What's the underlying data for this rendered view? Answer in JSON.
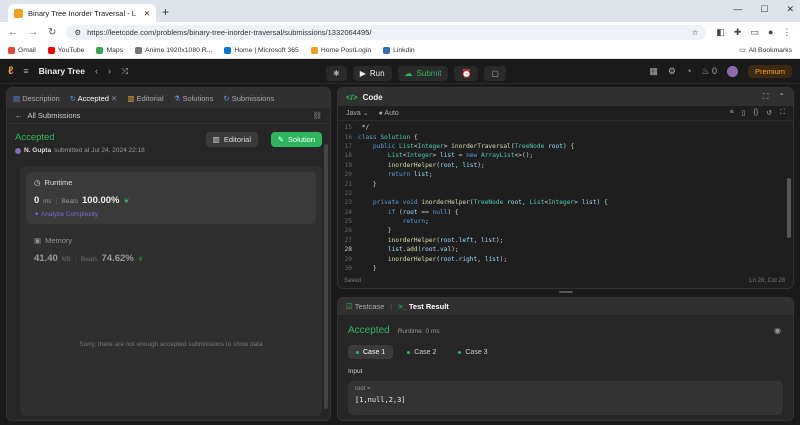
{
  "browser": {
    "tab_title": "Binary Tree Inorder Traversal - L",
    "url": "https://leetcode.com/problems/binary-tree-inorder-traversal/submissions/1332064495/",
    "bookmarks": [
      "Gmail",
      "YouTube",
      "Maps",
      "Anime 1920x1080 R...",
      "Home | Microsoft 365",
      "Home PostLogin",
      "Linkdin"
    ],
    "all_bookmarks": "All Bookmarks"
  },
  "topbar": {
    "problem_list": "Binary Tree",
    "run": "Run",
    "submit": "Submit",
    "streak": "0",
    "premium": "Premium"
  },
  "left": {
    "tabs": [
      "Description",
      "Accepted",
      "Editorial",
      "Solutions",
      "Submissions"
    ],
    "back_label": "All Submissions",
    "status": "Accepted",
    "user": "N. Gupta",
    "submitted": "submitted at Jul 24, 2024 22:18",
    "editorial_btn": "Editorial",
    "solution_btn": "Solution",
    "runtime_label": "Runtime",
    "runtime_value": "0",
    "runtime_unit": "ms",
    "beats_label": "Beats",
    "runtime_beats": "100.00%",
    "analyze": "Analyze Complexity",
    "memory_label": "Memory",
    "memory_value": "41.40",
    "memory_unit": "MB",
    "memory_beats": "74.62%",
    "no_data": "Sorry, there are not enough accepted submissions to show data"
  },
  "code": {
    "title": "Code",
    "language": "Java",
    "auto": "Auto",
    "saved": "Saved",
    "cursor": "Ln 28, Col 28"
  },
  "result": {
    "testcase_tab": "Testcase",
    "result_tab": "Test Result",
    "status": "Accepted",
    "runtime": "Runtime: 0 ms",
    "cases": [
      "Case 1",
      "Case 2",
      "Case 3"
    ],
    "input_label": "Input",
    "input_var": "root =",
    "input_value": "[1,null,2,3]"
  },
  "colors": {
    "accent_green": "#2db55d",
    "brand_orange": "#ffa116"
  }
}
